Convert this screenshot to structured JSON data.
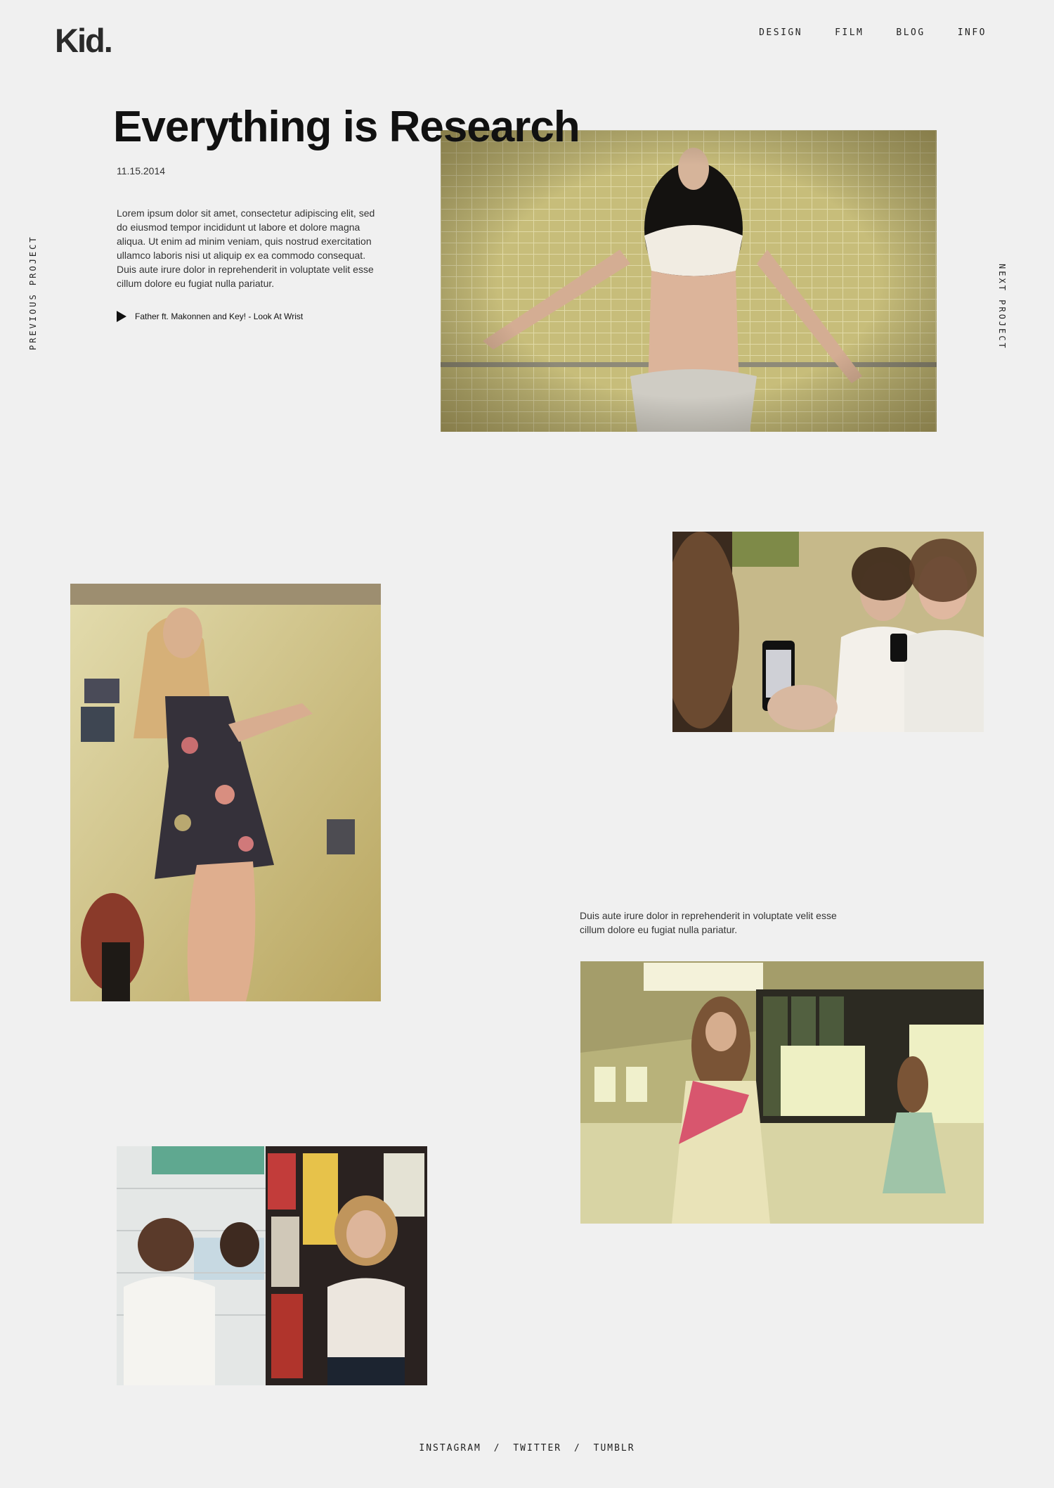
{
  "header": {
    "logo": "Kid.",
    "nav": [
      "DESIGN",
      "FILM",
      "BLOG",
      "INFO"
    ]
  },
  "side": {
    "previous": "PREVIOUS PROJECT",
    "next": "NEXT PROJECT"
  },
  "article": {
    "title": "Everything is Research",
    "date": "11.15.2014",
    "intro": "Lorem ipsum dolor sit amet, consectetur adipiscing elit, sed do eiusmod tempor incididunt ut labore et dolore magna aliqua. Ut enim ad minim veniam, quis nostrud exercitation ullamco laboris nisi ut aliquip ex ea commodo consequat. Duis aute irure dolor in reprehenderit in voluptate velit esse cillum dolore eu fugiat nulla pariatur.",
    "track": "Father ft. Makonnen and Key! - Look At Wrist",
    "caption": "Duis aute irure dolor in reprehenderit in voluptate velit esse cillum dolore eu fugiat nulla pariatur."
  },
  "footer": {
    "links": [
      "INSTAGRAM",
      "TWITTER",
      "TUMBLR"
    ],
    "separator": "/"
  },
  "colors": {
    "background": "#f0f0f0",
    "photo_tint": "#c9c07a"
  }
}
